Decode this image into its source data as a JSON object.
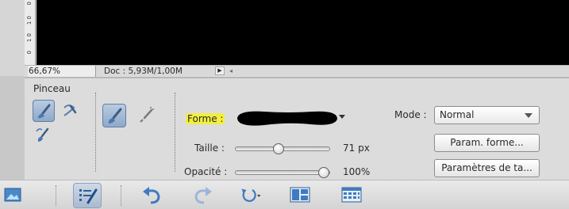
{
  "status": {
    "zoom": "66,67%",
    "doc": "Doc : 5,93M/1,00M",
    "play_glyph": "▶",
    "tick": "◂"
  },
  "ruler": {
    "marks": [
      "0",
      "1 0",
      "1 0",
      "0"
    ]
  },
  "panel": {
    "title": "Pinceau",
    "forme_label": "Forme :",
    "taille_label": "Taille :",
    "taille_value": "71 px",
    "taille_fraction": 0.45,
    "opacite_label": "Opacité :",
    "opacite_value": "100%",
    "opacite_fraction": 1.0,
    "mode_label": "Mode :",
    "mode_value": "Normal",
    "param_forme_button": "Param. forme...",
    "parametres_button": "Paramètres de ta..."
  },
  "taskbar": {
    "icons": [
      "photo-bin-icon",
      "tool-options-icon",
      "undo-icon",
      "redo-icon",
      "rotate-icon",
      "layout-icon",
      "organizer-icon"
    ]
  }
}
